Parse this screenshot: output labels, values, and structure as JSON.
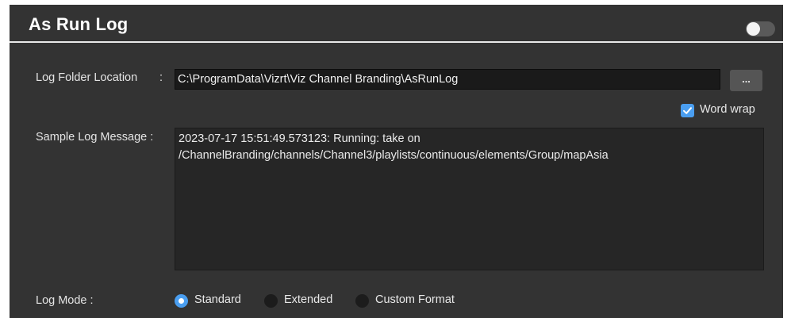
{
  "panel": {
    "title": "As Run Log",
    "enabled": false
  },
  "log_folder": {
    "label": "Log Folder Location",
    "separator": ":",
    "value": "C:\\ProgramData\\Vizrt\\Viz Channel Branding\\AsRunLog",
    "browse_label": "..."
  },
  "word_wrap": {
    "label": "Word wrap",
    "checked": true
  },
  "sample_message": {
    "label": "Sample Log Message :",
    "value": "2023-07-17 15:51:49.573123: Running: take on /ChannelBranding/channels/Channel3/playlists/continuous/elements/Group/mapAsia"
  },
  "log_mode": {
    "label": "Log Mode :",
    "options": [
      {
        "label": "Standard",
        "selected": true
      },
      {
        "label": "Extended",
        "selected": false
      },
      {
        "label": "Custom Format",
        "selected": false
      }
    ]
  },
  "colors": {
    "panel_bg": "#333333",
    "accent": "#4a9ef0",
    "input_bg": "#1a1a1a"
  }
}
